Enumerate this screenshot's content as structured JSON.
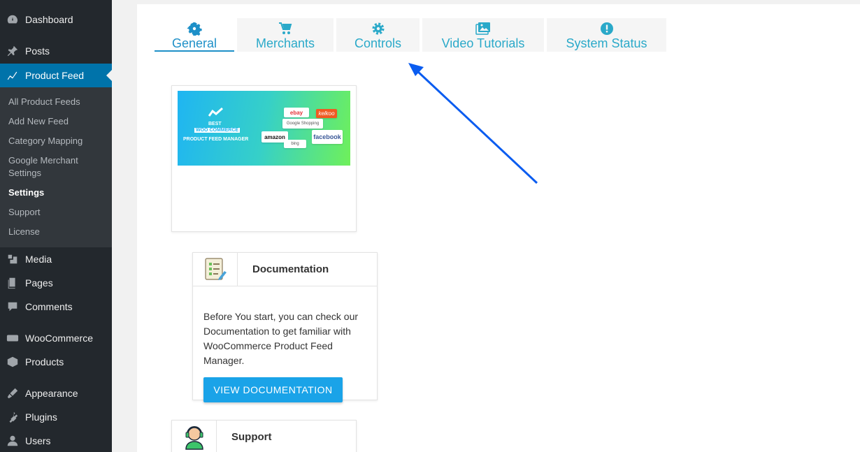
{
  "sidebar": {
    "items": [
      {
        "label": "Dashboard",
        "icon": "dashboard-icon"
      },
      {
        "label": "Posts",
        "icon": "pin-icon"
      },
      {
        "label": "Product Feed",
        "icon": "chart-icon"
      },
      {
        "label": "Media",
        "icon": "media-icon"
      },
      {
        "label": "Pages",
        "icon": "pages-icon"
      },
      {
        "label": "Comments",
        "icon": "comment-icon"
      },
      {
        "label": "WooCommerce",
        "icon": "woo-icon"
      },
      {
        "label": "Products",
        "icon": "box-icon"
      },
      {
        "label": "Appearance",
        "icon": "brush-icon"
      },
      {
        "label": "Plugins",
        "icon": "plug-icon"
      },
      {
        "label": "Users",
        "icon": "user-icon"
      }
    ],
    "submenu": [
      {
        "label": "All Product Feeds"
      },
      {
        "label": "Add New Feed"
      },
      {
        "label": "Category Mapping"
      },
      {
        "label": "Google Merchant Settings"
      },
      {
        "label": "Settings"
      },
      {
        "label": "Support"
      },
      {
        "label": "License"
      }
    ]
  },
  "tabs": [
    {
      "label": "General",
      "icon": "gear-icon"
    },
    {
      "label": "Merchants",
      "icon": "cart-icon"
    },
    {
      "label": "Controls",
      "icon": "gear-icon"
    },
    {
      "label": "Video Tutorials",
      "icon": "images-icon"
    },
    {
      "label": "System Status",
      "icon": "alert-icon"
    }
  ],
  "banner": {
    "line1": "BEST",
    "line2": "WOO COMMERCE",
    "line3": "PRODUCT FEED MANAGER",
    "logos": [
      "ebay",
      "kelkoo",
      "Google Shopping",
      "amazon",
      "facebook",
      "bing"
    ]
  },
  "documentation": {
    "title": "Documentation",
    "body": "Before You start, you can check our Documentation to get familiar with WooCommerce Product Feed Manager.",
    "button": "VIEW DOCUMENTATION"
  },
  "support": {
    "title": "Support"
  },
  "colors": {
    "sidebar_bg": "#23282d",
    "active_menu": "#0073aa",
    "tab_text": "#2aa9c9",
    "button": "#1aa3e8",
    "arrow": "#0a5cf0"
  }
}
